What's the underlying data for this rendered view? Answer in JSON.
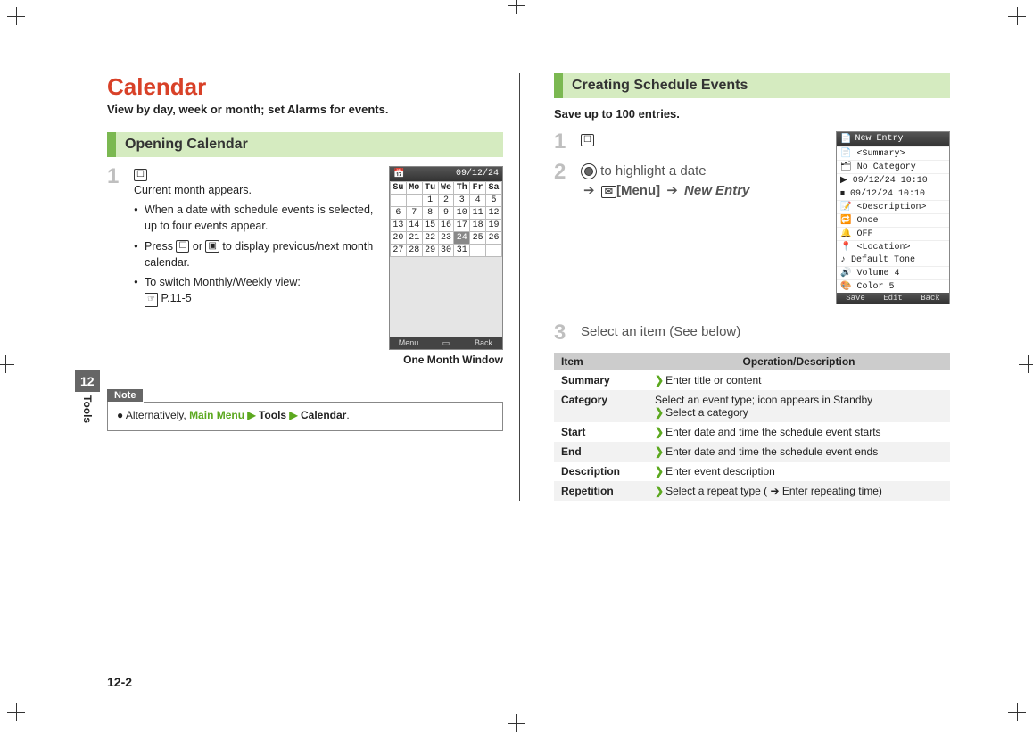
{
  "side": {
    "chapter_num": "12",
    "chapter_name": "Tools"
  },
  "page_num": "12-2",
  "left": {
    "title": "Calendar",
    "subtitle": "View by day, week or month; set Alarms for events.",
    "section": "Opening Calendar",
    "step1": {
      "line": "Current month appears.",
      "b1": "When a date with schedule events is selected, up to four events appear.",
      "b2_a": "Press ",
      "b2_b": " or ",
      "b2_c": " to display previous/next month calendar.",
      "b3_a": "To switch Monthly/Weekly view:",
      "b3_b": "P.11-5"
    },
    "shot_caption": "One Month Window",
    "cal": {
      "date_header": "09/12/24",
      "dow": [
        "Su",
        "Mo",
        "Tu",
        "We",
        "Th",
        "Fr",
        "Sa"
      ],
      "rows": [
        [
          "",
          "",
          "1",
          "2",
          "3",
          "4",
          "5"
        ],
        [
          "6",
          "7",
          "8",
          "9",
          "10",
          "11",
          "12"
        ],
        [
          "13",
          "14",
          "15",
          "16",
          "17",
          "18",
          "19"
        ],
        [
          "20",
          "21",
          "22",
          "23",
          "24",
          "25",
          "26"
        ],
        [
          "27",
          "28",
          "29",
          "30",
          "31",
          "",
          ""
        ]
      ],
      "highlight": "24",
      "soft_left": "Menu",
      "soft_right": "Back"
    },
    "note": {
      "label": "Note",
      "prefix": "Alternatively, ",
      "mm": "Main Menu",
      "tools": "Tools",
      "cal": "Calendar"
    }
  },
  "right": {
    "section": "Creating Schedule Events",
    "lead": "Save up to 100 entries.",
    "step2_text": " to highlight a date",
    "step2_menu": "[Menu]",
    "step2_new": "New Entry",
    "shot": {
      "title": "New Entry",
      "rows": [
        "📄 <Summary>",
        "🗂 No Category",
        "▶ 09/12/24 10:10",
        "⏹ 09/12/24 10:10",
        "📝 <Description>",
        "🔁 Once",
        "🔔 OFF",
        "📍 <Location>",
        "♪ Default Tone",
        "🔊 Volume 4",
        "🎨 Color 5"
      ],
      "soft_left": "Save",
      "soft_mid": "Edit",
      "soft_right": "Back"
    },
    "step3": "Select an item (See below)",
    "table": {
      "h1": "Item",
      "h2": "Operation/Description",
      "rows": [
        {
          "item": "Summary",
          "desc": "Enter title or content",
          "pre": ""
        },
        {
          "item": "Category",
          "pre": "Select an event type; icon appears in Standby",
          "desc": "Select a category"
        },
        {
          "item": "Start",
          "desc": "Enter date and time the schedule event starts",
          "pre": ""
        },
        {
          "item": "End",
          "desc": "Enter date and time the schedule event ends",
          "pre": ""
        },
        {
          "item": "Description",
          "desc": "Enter event description",
          "pre": ""
        },
        {
          "item": "Repetition",
          "desc": "Select a repeat type ( ➔ Enter repeating time)",
          "pre": ""
        }
      ]
    }
  }
}
